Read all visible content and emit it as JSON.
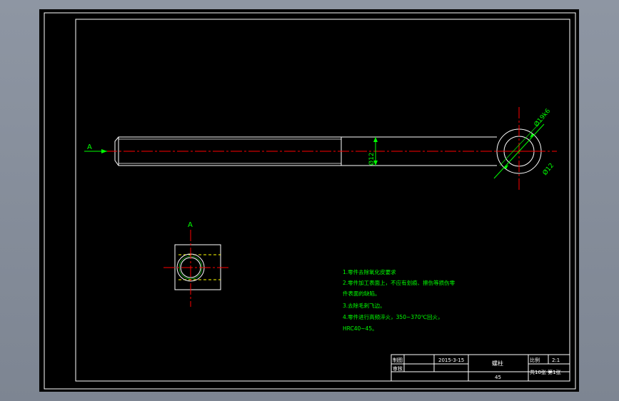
{
  "view_labels": {
    "section_top": "A",
    "section_left": "A"
  },
  "dimensions": {
    "shaft_diameter": "Ø12",
    "eye_outer": "Ø19k6",
    "eye_inner": "Ø12"
  },
  "technical_requirements": [
    "1.零件去除氧化皮要求",
    "2.零件加工表面上，不应有划痕、擦伤等损伤零",
    "件表面的缺陷。",
    "3.去除毛刺飞边。",
    "4.零件进行高频淬火，350~370℃回火，",
    "HRC40~45。"
  ],
  "title_block": {
    "drawn_label": "制图",
    "checked_label": "审核",
    "date": "2015-3-15",
    "part_name": "螺柱",
    "material": "45",
    "scale_label": "比例",
    "scale_value": "2:1",
    "sheet_info": "共10张 第1张"
  },
  "colors": {
    "background": "#000000",
    "outline": "#ffffff",
    "center_line": "#ff0000",
    "dimension": "#00ff00",
    "hidden_line": "#ffff00",
    "text": "#00ff00"
  }
}
